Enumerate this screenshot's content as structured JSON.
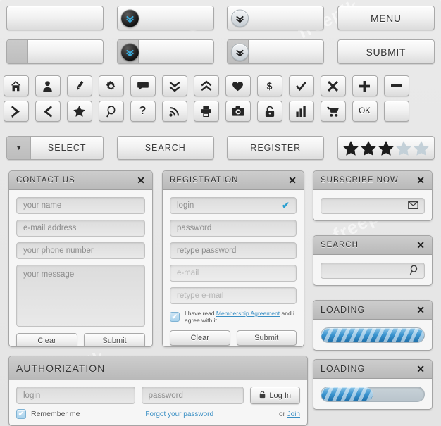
{
  "watermarks": [
    "freepik",
    "freepik",
    "freepik",
    "freepik"
  ],
  "row1": {
    "items": [
      {
        "name": "text-input-plain",
        "type": "input",
        "value": "",
        "badge": null
      },
      {
        "name": "text-input-dark-badge",
        "type": "input",
        "value": "",
        "badge": "dark",
        "badge_icon": "double-chevron-down-icon"
      },
      {
        "name": "text-input-light-badge",
        "type": "input",
        "value": "",
        "badge": "light",
        "badge_icon": "double-chevron-down-icon"
      },
      {
        "name": "menu-button",
        "type": "button",
        "label": "MENU"
      }
    ]
  },
  "row2": {
    "items": [
      {
        "name": "text-input-prefix-plain",
        "type": "input-prefix",
        "value": "",
        "badge": null
      },
      {
        "name": "text-input-prefix-dark-badge",
        "type": "input-prefix",
        "value": "",
        "badge": "dark",
        "badge_icon": "double-chevron-down-icon"
      },
      {
        "name": "text-input-prefix-light-badge",
        "type": "input-prefix",
        "value": "",
        "badge": "light",
        "badge_icon": "double-chevron-down-icon"
      },
      {
        "name": "submit-button",
        "type": "button",
        "label": "SUBMIT"
      }
    ]
  },
  "icon_row_1": [
    {
      "name": "home-icon",
      "glyph": "home"
    },
    {
      "name": "user-icon",
      "glyph": "user"
    },
    {
      "name": "pencil-icon",
      "glyph": "pencil"
    },
    {
      "name": "gear-icon",
      "glyph": "gear"
    },
    {
      "name": "chat-bubble-icon",
      "glyph": "chat"
    },
    {
      "name": "double-chevron-down-icon",
      "glyph": "chev-down"
    },
    {
      "name": "double-chevron-up-icon",
      "glyph": "chev-up"
    },
    {
      "name": "heart-icon",
      "glyph": "heart"
    },
    {
      "name": "dollar-icon",
      "glyph": "dollar",
      "text": "$"
    },
    {
      "name": "check-icon",
      "glyph": "check"
    },
    {
      "name": "close-x-icon",
      "glyph": "x"
    },
    {
      "name": "plus-icon",
      "glyph": "plus"
    },
    {
      "name": "minus-icon",
      "glyph": "minus"
    }
  ],
  "icon_row_2": [
    {
      "name": "chevron-right-icon",
      "glyph": "right"
    },
    {
      "name": "chevron-left-icon",
      "glyph": "left"
    },
    {
      "name": "star-icon",
      "glyph": "star"
    },
    {
      "name": "search-magnifier-icon",
      "glyph": "magnifier"
    },
    {
      "name": "question-mark-icon",
      "glyph": "question",
      "text": "?"
    },
    {
      "name": "rss-icon",
      "glyph": "rss"
    },
    {
      "name": "printer-icon",
      "glyph": "printer"
    },
    {
      "name": "camera-icon",
      "glyph": "camera"
    },
    {
      "name": "lock-icon",
      "glyph": "lock"
    },
    {
      "name": "bar-chart-icon",
      "glyph": "chart"
    },
    {
      "name": "shopping-cart-icon",
      "glyph": "cart"
    },
    {
      "name": "ok-button",
      "glyph": "text",
      "text": "OK"
    },
    {
      "name": "blank-button",
      "glyph": "blank"
    }
  ],
  "action_row": {
    "select": {
      "label": "SELECT",
      "arrow_icon": "triangle-down-icon"
    },
    "search": {
      "label": "SEARCH"
    },
    "register": {
      "label": "REGISTER"
    },
    "rating": {
      "filled": 3,
      "total": 5,
      "filled_color": "#1c1c1c",
      "empty_color": "#c3d0d8"
    }
  },
  "contact_panel": {
    "title": "CONTACT US",
    "close_icon": "close-x-icon",
    "fields": [
      {
        "name": "name-field",
        "placeholder": "your name"
      },
      {
        "name": "email-field",
        "placeholder": "e-mail address"
      },
      {
        "name": "phone-field",
        "placeholder": "your phone number"
      }
    ],
    "message": {
      "name": "message-textarea",
      "placeholder": "your message"
    },
    "clear_label": "Clear",
    "submit_label": "Submit"
  },
  "registration_panel": {
    "title": "REGISTRATION",
    "close_icon": "close-x-icon",
    "fields": [
      {
        "name": "login-field",
        "placeholder": "login",
        "valid": true,
        "faint": false
      },
      {
        "name": "password-field",
        "placeholder": "password",
        "valid": false,
        "faint": false
      },
      {
        "name": "retype-password-field",
        "placeholder": "retype password",
        "valid": false,
        "faint": false
      },
      {
        "name": "email-field",
        "placeholder": "e-mail",
        "valid": false,
        "faint": true
      },
      {
        "name": "retype-email-field",
        "placeholder": "retype e-mail",
        "valid": false,
        "faint": true
      }
    ],
    "agreement": {
      "checked": true,
      "before": "I have read ",
      "link": "Membership Agreement",
      "after": " and i agree with it"
    },
    "clear_label": "Clear",
    "submit_label": "Submit"
  },
  "subscribe_panel": {
    "title": "SUBSCRIBE NOW",
    "close_icon": "close-x-icon",
    "field": {
      "name": "subscribe-email-field",
      "placeholder": "",
      "icon": "envelope-icon"
    }
  },
  "search_panel": {
    "title": "SEARCH",
    "close_icon": "close-x-icon",
    "field": {
      "name": "search-input",
      "placeholder": "",
      "icon": "search-magnifier-icon"
    }
  },
  "loading_panels": [
    {
      "name": "loading-panel-full",
      "title": "LOADING",
      "close_icon": "close-x-icon",
      "progress": 100
    },
    {
      "name": "loading-panel-half",
      "title": "LOADING",
      "close_icon": "close-x-icon",
      "progress": 50
    }
  ],
  "authorization_panel": {
    "title": "AUTHORIZATION",
    "login": {
      "name": "auth-login-field",
      "placeholder": "login"
    },
    "password": {
      "name": "auth-password-field",
      "placeholder": "password"
    },
    "login_button": {
      "label": "Log In",
      "icon": "lock-icon"
    },
    "remember": {
      "checked": true,
      "label": "Remember me"
    },
    "forgot_label": "Forgot your password",
    "or_label": "or ",
    "join_label": "Join"
  },
  "colors": {
    "accent": "#3a8fc4",
    "progress": "#3b94cf",
    "badge_blue": "#3aaee0"
  }
}
